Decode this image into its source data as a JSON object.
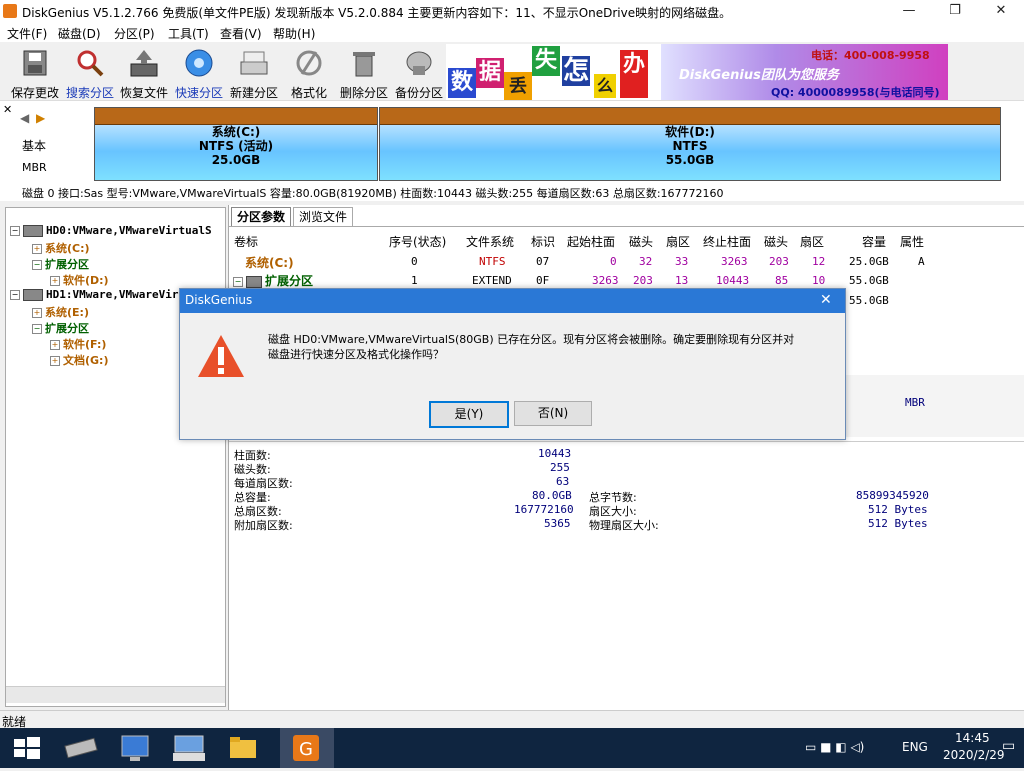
{
  "window": {
    "title": "DiskGenius V5.1.2.766 免费版(单文件PE版)   发现新版本 V5.2.0.884 主要更新内容如下：11、不显示OneDrive映射的网络磁盘。",
    "minimize": "—",
    "restore": "❐",
    "close": "✕"
  },
  "menu": [
    "文件(F)",
    "磁盘(D)",
    "分区(P)",
    "工具(T)",
    "查看(V)",
    "帮助(H)"
  ],
  "toolbar": [
    "保存更改",
    "搜索分区",
    "恢复文件",
    "快速分区",
    "新建分区",
    "格式化",
    "删除分区",
    "备份分区"
  ],
  "banner": {
    "chars": [
      "数",
      "据",
      "丢",
      "失",
      "怎",
      "么",
      "办"
    ],
    "team": "DiskGenius团队为您服务",
    "phone": "电话：400-008-9958",
    "qq": "QQ: 4000089958(与电话同号)"
  },
  "diskmap": {
    "basic": "基本",
    "mbr": "MBR",
    "parts": [
      {
        "name": "系统(C:)",
        "fs": "NTFS (活动)",
        "size": "25.0GB"
      },
      {
        "name": "软件(D:)",
        "fs": "NTFS",
        "size": "55.0GB"
      }
    ]
  },
  "diskinfo": "磁盘 0 接口:Sas  型号:VMware,VMwareVirtualS  容量:80.0GB(81920MB)  柱面数:10443  磁头数:255  每道扇区数:63  总扇区数:167772160",
  "tree": {
    "hd0": "HD0:VMware,VMwareVirtualS",
    "hd0_c": "系统(C:)",
    "hd0_ext": "扩展分区",
    "hd0_d": "软件(D:)",
    "hd1": "HD1:VMware,VMwareVirtualS",
    "hd1_e": "系统(E:)",
    "hd1_ext": "扩展分区",
    "hd1_f": "软件(F:)",
    "hd1_g": "文档(G:)"
  },
  "tabs": [
    "分区参数",
    "浏览文件"
  ],
  "table": {
    "headers": [
      "卷标",
      "序号(状态)",
      "文件系统",
      "标识",
      "起始柱面",
      "磁头",
      "扇区",
      "终止柱面",
      "磁头",
      "扇区",
      "容量",
      "属性"
    ],
    "rows": [
      {
        "label": "系统(C:)",
        "no": "0",
        "fs": "NTFS",
        "id": "07",
        "sc": "0",
        "sh": "32",
        "ss": "33",
        "ec": "3263",
        "eh": "203",
        "es": "12",
        "cap": "25.0GB",
        "attr": "A"
      },
      {
        "label": "扩展分区",
        "no": "1",
        "fs": "EXTEND",
        "id": "0F",
        "sc": "3263",
        "sh": "203",
        "ss": "13",
        "ec": "10443",
        "eh": "85",
        "es": "10",
        "cap": "55.0GB",
        "attr": ""
      }
    ],
    "row3_cap": "55.0GB"
  },
  "details": {
    "mbr": "MBR",
    "cyl_label": "柱面数:",
    "cyl": "10443",
    "heads_label": "磁头数:",
    "heads": "255",
    "spt_label": "每道扇区数:",
    "spt": "63",
    "cap_label": "总容量:",
    "cap": "80.0GB",
    "bytes_label": "总字节数:",
    "bytes": "85899345920",
    "sectors_label": "总扇区数:",
    "sectors": "167772160",
    "secsize_label": "扇区大小:",
    "secsize": "512 Bytes",
    "extra_label": "附加扇区数:",
    "extra": "5365",
    "phys_label": "物理扇区大小:",
    "phys": "512 Bytes"
  },
  "dialog": {
    "title": "DiskGenius",
    "line1": "磁盘 HD0:VMware,VMwareVirtualS(80GB) 已存在分区。现有分区将会被删除。确定要删除现有分区并对",
    "line2": "磁盘进行快速分区及格式化操作吗？",
    "yes": "是(Y)",
    "no": "否(N)",
    "close": "✕"
  },
  "status": "就绪",
  "taskbar": {
    "time": "14:45",
    "date": "2020/2/29",
    "lang": "ENG"
  },
  "colors": {
    "accent": "#2a78d6",
    "highlight_row": "#0a246a"
  }
}
